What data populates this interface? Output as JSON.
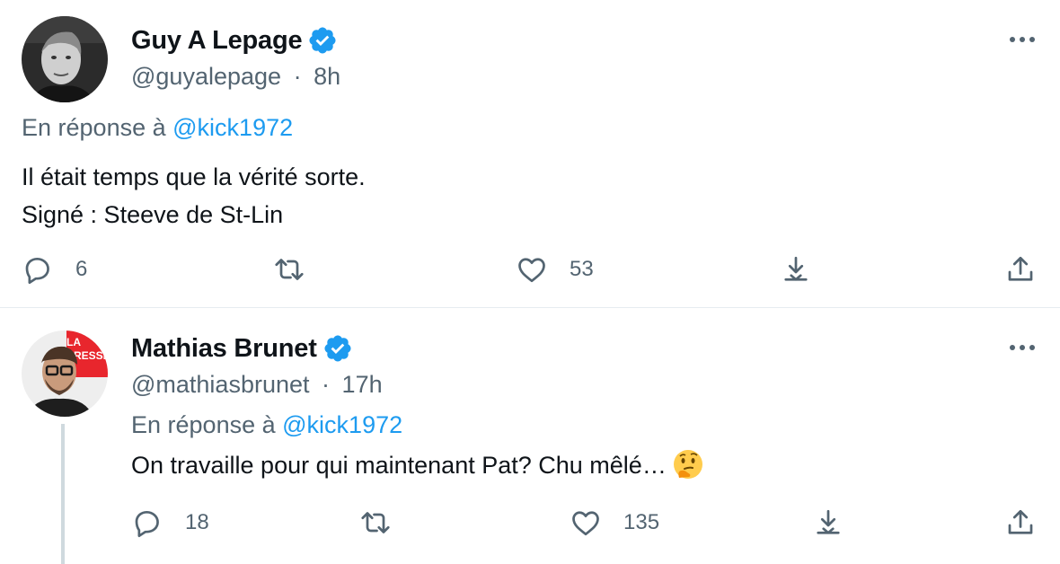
{
  "tweets": [
    {
      "name": "Guy A Lepage",
      "handle": "@guyalepage",
      "separator": "·",
      "time": "8h",
      "reply_prefix": "En réponse à",
      "reply_mention": "@kick1972",
      "text_lines": [
        "Il était temps que la vérité sorte.",
        "Signé : Steeve de St-Lin"
      ],
      "reply_count": "6",
      "retweet_count": "",
      "like_count": "53"
    },
    {
      "name": "Mathias Brunet",
      "handle": "@mathiasbrunet",
      "separator": "·",
      "time": "17h",
      "reply_prefix": "En réponse à",
      "reply_mention": "@kick1972",
      "text": "On travaille pour qui maintenant Pat? Chu mêlé…",
      "emoji": "thinking-face",
      "avatar_badge": "LA PRESSE",
      "reply_count": "18",
      "retweet_count": "",
      "like_count": "135"
    }
  ],
  "colors": {
    "text": "#0f1419",
    "secondary": "#536471",
    "accent": "#1d9bf0",
    "divider": "#e6ecf0",
    "thread_line": "#cfd9de",
    "avatar_badge": "#e8262d"
  },
  "icons": [
    "verified-badge-icon",
    "more-dots-icon",
    "reply-icon",
    "retweet-icon",
    "like-icon",
    "download-icon",
    "share-icon",
    "thinking-face-emoji"
  ]
}
